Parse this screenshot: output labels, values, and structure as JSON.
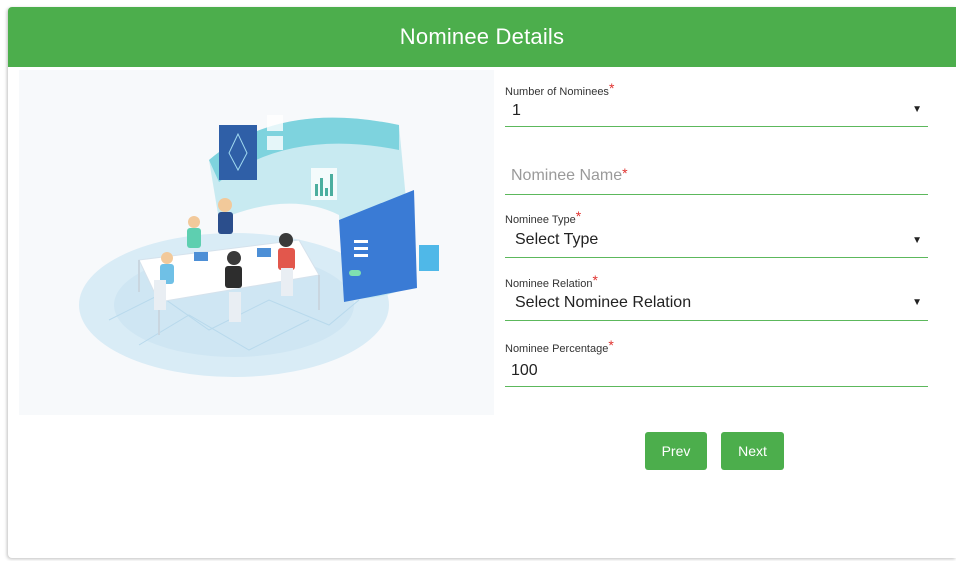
{
  "header": {
    "title": "Nominee Details"
  },
  "form": {
    "num_nominees": {
      "label": "Number of Nominees",
      "value": "1"
    },
    "nominee_name": {
      "placeholder": "Nominee Name"
    },
    "nominee_type": {
      "label": "Nominee Type",
      "value": "Select Type"
    },
    "nominee_relation": {
      "label": "Nominee Relation",
      "value": "Select Nominee Relation"
    },
    "nominee_percentage": {
      "label": "Nominee Percentage",
      "value": "100"
    },
    "required_marker": "*",
    "dropdown_caret": "▼"
  },
  "buttons": {
    "prev": "Prev",
    "next": "Next"
  },
  "colors": {
    "accent": "#4cae4c",
    "required": "#e0322f",
    "underline": "#5cb85c"
  },
  "illustration": {
    "icon": "team-meeting-illustration"
  }
}
